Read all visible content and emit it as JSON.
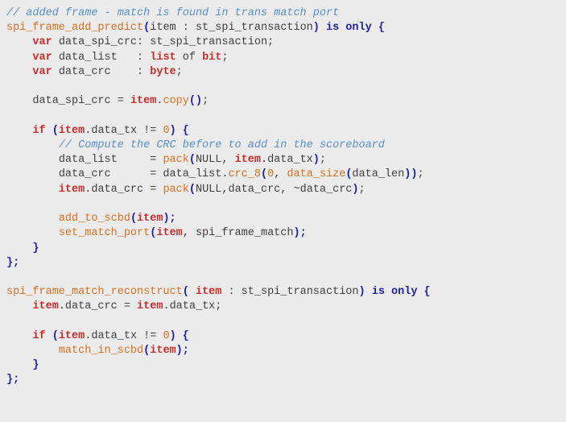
{
  "code": {
    "l1_comment": "// added frame - match is found in trans match port",
    "l2_fn": "spi_frame_add_predict",
    "l2_open": "(",
    "l2_param": "item : st_spi_transaction",
    "l2_close": ")",
    "l2_is": " is only ",
    "l2_brace": "{",
    "l3_indent": "    ",
    "l3_var": "var",
    "l3_rest": " data_spi_crc: st_spi_transaction;",
    "l4_indent": "    ",
    "l4_var": "var",
    "l4_name": " data_list   : ",
    "l4_list": "list",
    "l4_of": " of ",
    "l4_bit": "bit",
    "l4_semi": ";",
    "l5_indent": "    ",
    "l5_var": "var",
    "l5_name": " data_crc    : ",
    "l5_byte": "byte",
    "l5_semi": ";",
    "l6_blank": "",
    "l7_indent": "    ",
    "l7_lhs": "data_spi_crc = ",
    "l7_item": "item",
    "l7_dot": ".",
    "l7_copy": "copy",
    "l7_parens": "()",
    "l7_semi": ";",
    "l8_blank": "",
    "l9_indent": "    ",
    "l9_if": "if",
    "l9_sp": " ",
    "l9_open": "(",
    "l9_item": "item",
    "l9_dot": ".",
    "l9_rest": "data_tx != ",
    "l9_zero": "0",
    "l9_close": ")",
    "l9_sp2": " ",
    "l9_brace": "{",
    "l10_indent": "        ",
    "l10_comment": "// Compute the CRC before to add in the scoreboard",
    "l11_indent": "        ",
    "l11_lhs": "data_list     = ",
    "l11_pack": "pack",
    "l11_open": "(",
    "l11_null": "NULL, ",
    "l11_item": "item",
    "l11_dot": ".",
    "l11_rest": "data_tx",
    "l11_close": ")",
    "l11_semi": ";",
    "l12_indent": "        ",
    "l12_lhs": "data_crc      = data_list.",
    "l12_crc8": "crc_8",
    "l12_open": "(",
    "l12_zero": "0",
    "l12_comma": ", ",
    "l12_ds": "data_size",
    "l12_open2": "(",
    "l12_arg": "data_len",
    "l12_close2": ")",
    "l12_close": ")",
    "l12_semi": ";",
    "l13_indent": "        ",
    "l13_item": "item",
    "l13_dot": ".",
    "l13_lhs": "data_crc = ",
    "l13_pack": "pack",
    "l13_open": "(",
    "l13_args": "NULL,data_crc, ~data_crc",
    "l13_close": ")",
    "l13_semi": ";",
    "l14_blank": "",
    "l15_indent": "        ",
    "l15_fn": "add_to_scbd",
    "l15_open": "(",
    "l15_item": "item",
    "l15_close": ");",
    "l16_indent": "        ",
    "l16_fn": "set_match_port",
    "l16_open": "(",
    "l16_item": "item",
    "l16_rest": ", spi_frame_match",
    "l16_close": ");",
    "l17_indent": "    ",
    "l17_brace": "}",
    "l18_brace": "};",
    "l19_blank": "",
    "l20_fn": "spi_frame_match_reconstruct",
    "l20_open": "(",
    "l20_sp": " ",
    "l20_item": "item",
    "l20_rest": " : st_spi_transaction",
    "l20_close": ")",
    "l20_is": " is only ",
    "l20_brace": "{",
    "l21_indent": "    ",
    "l21_item": "item",
    "l21_dot": ".",
    "l21_lhs": "data_crc = ",
    "l21_item2": "item",
    "l21_dot2": ".",
    "l21_rhs": "data_tx;",
    "l22_blank": "",
    "l23_indent": "    ",
    "l23_if": "if",
    "l23_sp": " ",
    "l23_open": "(",
    "l23_item": "item",
    "l23_dot": ".",
    "l23_rest": "data_tx != ",
    "l23_zero": "0",
    "l23_close": ")",
    "l23_sp2": " ",
    "l23_brace": "{",
    "l24_indent": "        ",
    "l24_fn": "match_in_scbd",
    "l24_open": "(",
    "l24_item": "item",
    "l24_close": ");",
    "l25_indent": "    ",
    "l25_brace": "}",
    "l26_brace": "};"
  }
}
